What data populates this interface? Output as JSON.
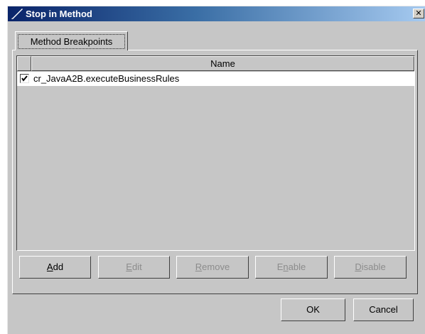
{
  "window": {
    "title": "Stop in Method",
    "close_glyph": "✕"
  },
  "tab": {
    "label": "Method Breakpoints"
  },
  "table": {
    "columns": [
      "",
      "Name"
    ],
    "rows": [
      {
        "checked": true,
        "name": "cr_JavaA2B.executeBusinessRules"
      }
    ]
  },
  "buttons": {
    "add": {
      "mnemonic": "A",
      "rest": "dd",
      "enabled": true
    },
    "edit": {
      "mnemonic": "E",
      "rest": "dit",
      "enabled": false
    },
    "remove": {
      "mnemonic": "R",
      "rest": "emove",
      "enabled": false
    },
    "enable": {
      "pre": "E",
      "mnemonic": "n",
      "rest": "able",
      "enabled": false
    },
    "disable": {
      "mnemonic": "D",
      "rest": "isable",
      "enabled": false
    }
  },
  "dialog": {
    "ok_label": "OK",
    "cancel_label": "Cancel"
  },
  "colors": {
    "title_gradient_start": "#0a246a",
    "title_gradient_end": "#a6caf0",
    "panel_bg": "#c6c6c6",
    "disabled_text": "#8c8c8c"
  }
}
